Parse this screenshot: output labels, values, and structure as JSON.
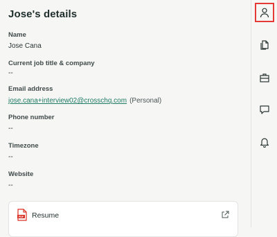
{
  "panel": {
    "title": "Jose's details",
    "fields": [
      {
        "label": "Name",
        "value": "Jose Cana"
      },
      {
        "label": "Current job title & company",
        "value": "--"
      },
      {
        "label": "Email address",
        "value": "jose.cana+interview02@crosschq.com",
        "note": "(Personal)"
      },
      {
        "label": "Phone number",
        "value": "--"
      },
      {
        "label": "Timezone",
        "value": "--"
      },
      {
        "label": "Website",
        "value": "--"
      }
    ],
    "resume": {
      "label": "Resume",
      "badge": "PDF"
    }
  },
  "sidebar": {
    "items": [
      {
        "icon": "person-icon",
        "active": true
      },
      {
        "icon": "documents-icon",
        "active": false
      },
      {
        "icon": "briefcase-icon",
        "active": false
      },
      {
        "icon": "chat-icon",
        "active": false
      },
      {
        "icon": "bell-icon",
        "active": false
      }
    ]
  },
  "colors": {
    "accent": "#1f7a62",
    "highlight": "#e53935",
    "pdf_red": "#d93025"
  }
}
